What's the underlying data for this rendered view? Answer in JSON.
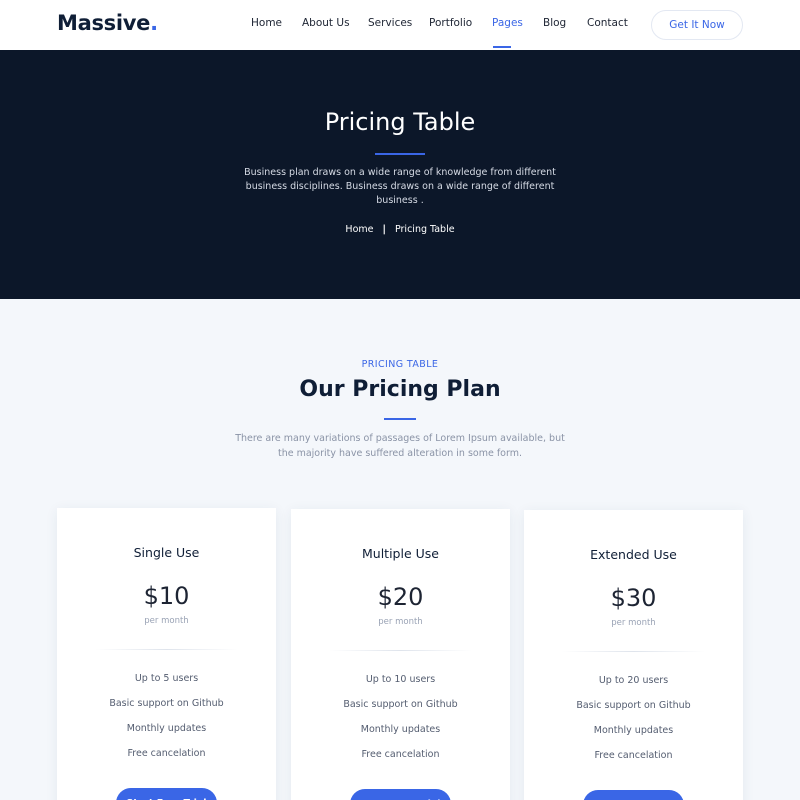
{
  "header": {
    "logo": "Massive",
    "logo_dot": ".",
    "nav": [
      "Home",
      "About Us",
      "Services",
      "Portfolio",
      "Pages",
      "Blog",
      "Contact"
    ],
    "active_nav": "Pages",
    "cta": "Get It Now"
  },
  "hero": {
    "title": "Pricing Table",
    "description": "Business plan draws on a wide range of knowledge from different business disciplines. Business draws on a wide range of different business .",
    "breadcrumb": {
      "home": "Home",
      "separator": "|",
      "current": "Pricing Table"
    }
  },
  "section": {
    "eyebrow": "PRICING TABLE",
    "title": "Our Pricing Plan",
    "description": "There are many variations of passages of Lorem Ipsum available, but the majority have suffered alteration in some form."
  },
  "plans": [
    {
      "name": "Single Use",
      "price": "$10",
      "period": "per month",
      "features": [
        "Up to 5 users",
        "Basic support on Github",
        "Monthly updates",
        "Free cancelation"
      ],
      "button": "Start Free Trial"
    },
    {
      "name": "Multiple Use",
      "price": "$20",
      "period": "per month",
      "features": [
        "Up to 10 users",
        "Basic support on Github",
        "Monthly updates",
        "Free cancelation"
      ],
      "button": "Start Free Trial"
    },
    {
      "name": "Extended Use",
      "price": "$30",
      "period": "per month",
      "features": [
        "Up to 20 users",
        "Basic support on Github",
        "Monthly updates",
        "Free cancelation"
      ],
      "button": "Start Free Trial"
    }
  ],
  "colors": {
    "accent": "#3a66e6",
    "hero_bg": "#0c1729",
    "page_bg": "#f4f7fb",
    "heading": "#0f1e36"
  }
}
